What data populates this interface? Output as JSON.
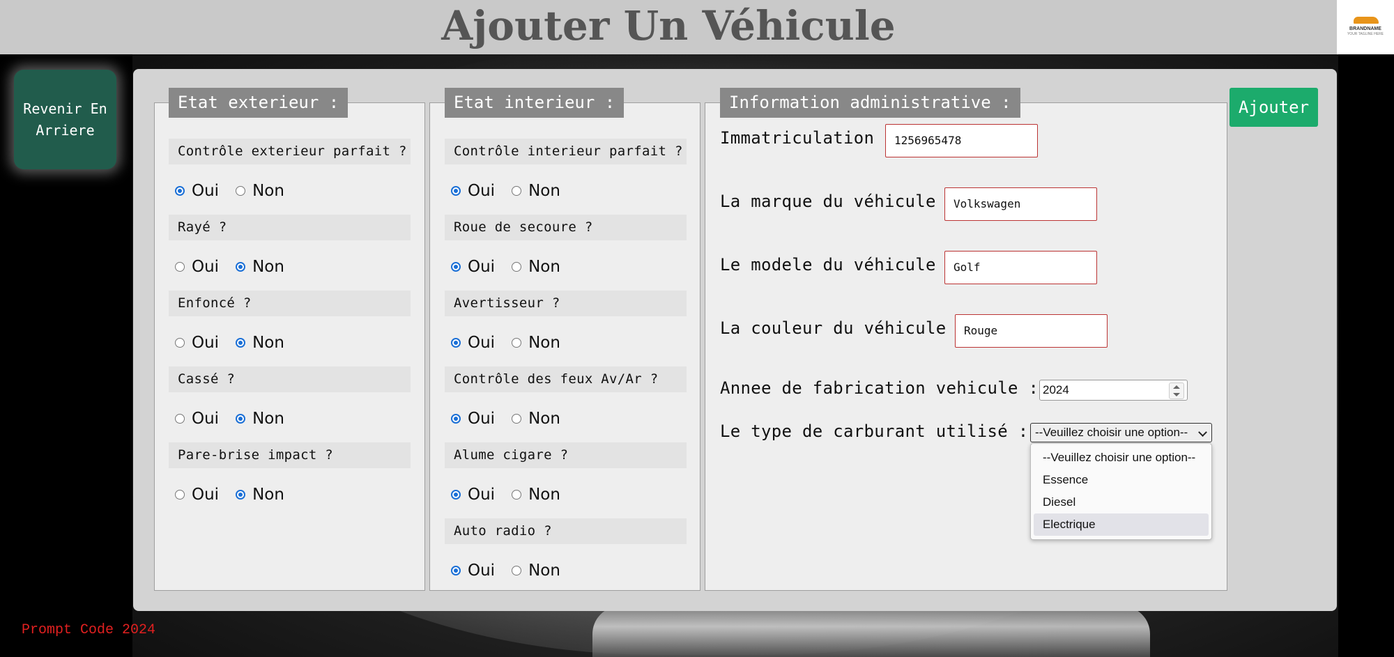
{
  "header": {
    "title": "Ajouter Un Véhicule",
    "logo_text": "BRANDNAME",
    "logo_sub": "YOUR TAGLINE HERE"
  },
  "back_button": {
    "label": "Revenir En Arriere"
  },
  "add_button": {
    "label": "Ajouter"
  },
  "exterieur": {
    "legend": "Etat exterieur :",
    "questions": [
      {
        "label": "Contrôle exterieur parfait ?",
        "oui": "Oui",
        "non": "Non",
        "selected": "Oui"
      },
      {
        "label": "Rayé ?",
        "oui": "Oui",
        "non": "Non",
        "selected": "Non"
      },
      {
        "label": "Enfoncé ?",
        "oui": "Oui",
        "non": "Non",
        "selected": "Non"
      },
      {
        "label": "Cassé ?",
        "oui": "Oui",
        "non": "Non",
        "selected": "Non"
      },
      {
        "label": "Pare-brise impact ?",
        "oui": "Oui",
        "non": "Non",
        "selected": "Non"
      }
    ]
  },
  "interieur": {
    "legend": "Etat interieur :",
    "questions": [
      {
        "label": "Contrôle interieur parfait ?",
        "oui": "Oui",
        "non": "Non",
        "selected": "Oui"
      },
      {
        "label": "Roue de secoure ?",
        "oui": "Oui",
        "non": "Non",
        "selected": "Oui"
      },
      {
        "label": "Avertisseur ?",
        "oui": "Oui",
        "non": "Non",
        "selected": "Oui"
      },
      {
        "label": "Contrôle des feux Av/Ar ?",
        "oui": "Oui",
        "non": "Non",
        "selected": "Oui"
      },
      {
        "label": "Alume cigare ?",
        "oui": "Oui",
        "non": "Non",
        "selected": "Oui"
      },
      {
        "label": "Auto radio ?",
        "oui": "Oui",
        "non": "Non",
        "selected": "Oui"
      }
    ]
  },
  "admin": {
    "legend": "Information administrative :",
    "immatriculation": {
      "label": "Immatriculation :",
      "value": "1256965478"
    },
    "marque": {
      "label": "La marque du véhicule :",
      "value": "Volkswagen"
    },
    "modele": {
      "label": "Le modele du véhicule :",
      "value": "Golf"
    },
    "couleur": {
      "label": "La couleur du véhicule :",
      "value": "Rouge"
    },
    "annee": {
      "label": "Annee de fabrication vehicule :",
      "value": "2024"
    },
    "carburant": {
      "label": "Le type de carburant utilisé :",
      "selected": "--Veuillez choisir une option--",
      "options": [
        "--Veuillez choisir une option--",
        "Essence",
        "Diesel",
        "Electrique"
      ],
      "hovered": "Electrique"
    }
  },
  "footer": {
    "text": "Prompt Code 2024"
  },
  "colors": {
    "accent_green": "#1cab6c",
    "back_button": "#215c4c",
    "legend_bg": "#888888",
    "radio_on": "#1a6fd6",
    "footer_red": "#e02020"
  }
}
